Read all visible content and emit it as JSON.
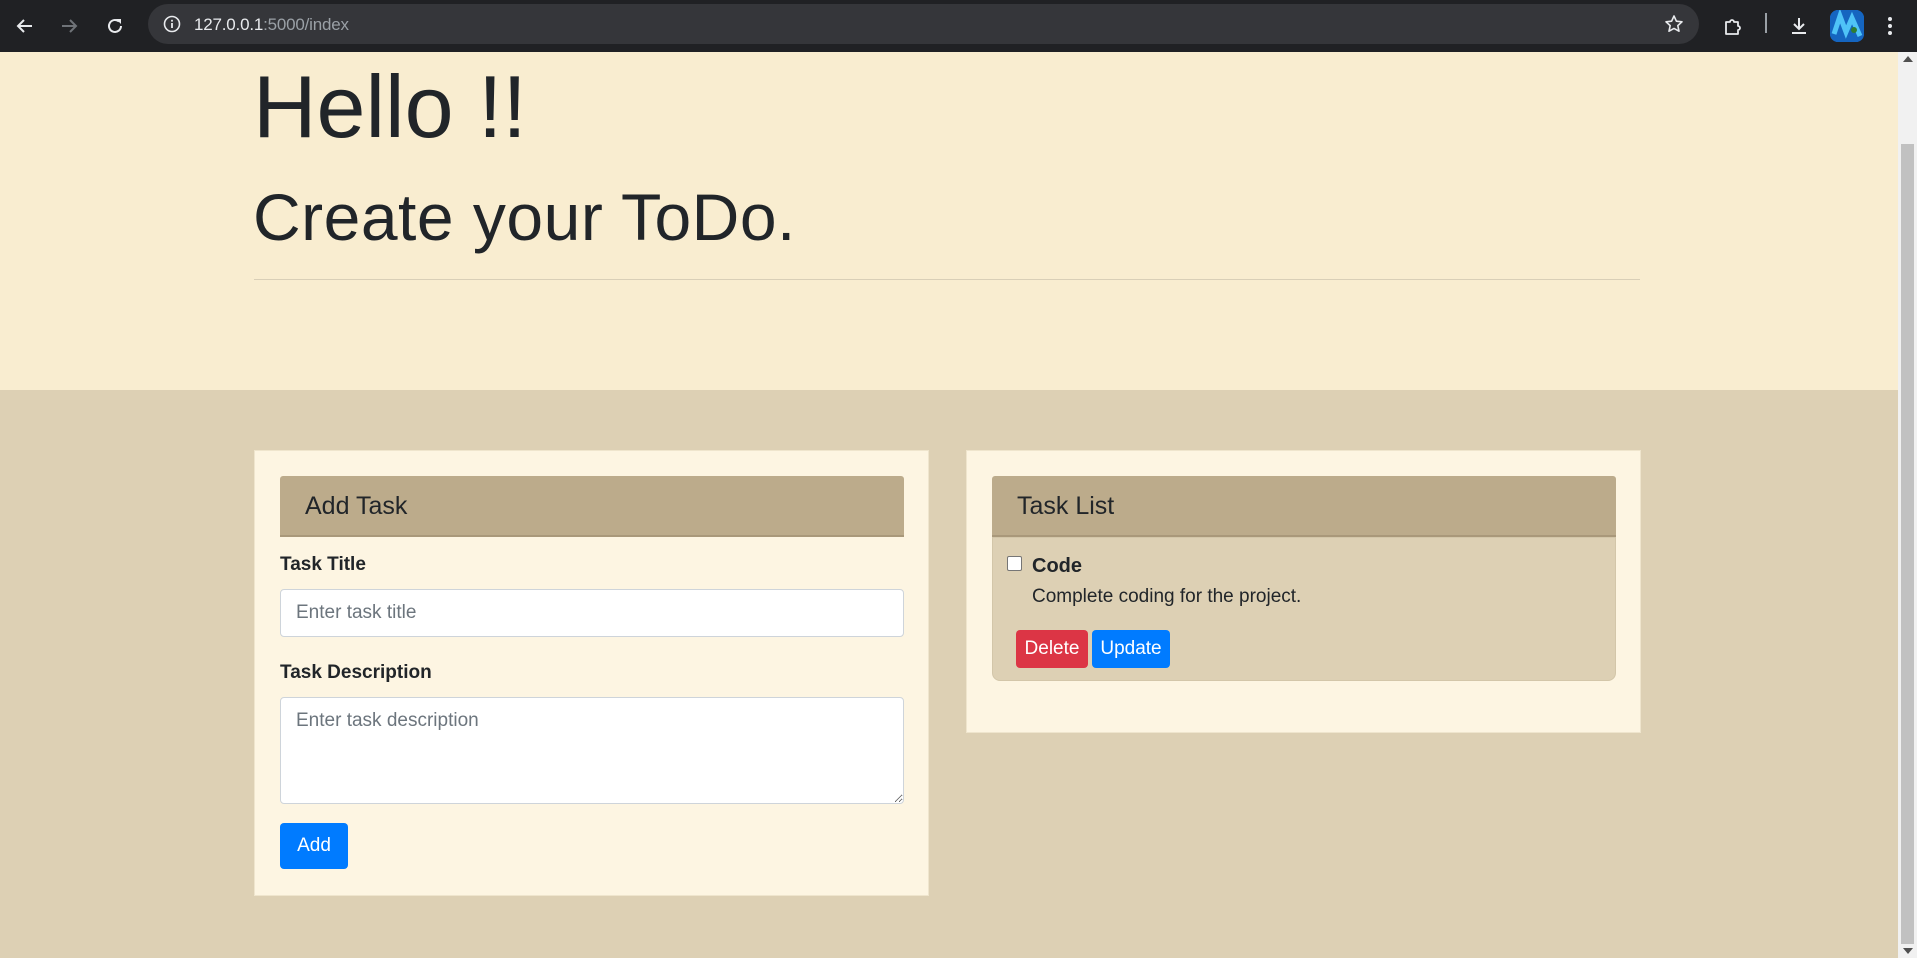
{
  "browser": {
    "url_host": "127.0.0.1",
    "url_path": ":5000/index",
    "icons": {
      "back": "back-arrow-icon",
      "forward": "forward-arrow-icon",
      "reload": "reload-icon",
      "info": "site-info-icon",
      "bookmark": "star-icon",
      "extensions": "puzzle-icon",
      "downloads": "download-icon",
      "profile": "profile-avatar-icon",
      "menu": "kebab-menu-icon"
    }
  },
  "hero": {
    "greeting": "Hello !!",
    "lead": "Create your ToDo."
  },
  "add_task": {
    "header": "Add Task",
    "title_label": "Task Title",
    "title_placeholder": "Enter task title",
    "title_value": "",
    "description_label": "Task Description",
    "description_placeholder": "Enter task description",
    "description_value": "",
    "add_button": "Add"
  },
  "task_list": {
    "header": "Task List",
    "tasks": [
      {
        "title": "Code",
        "description": "Complete coding for the project.",
        "completed": false,
        "delete_label": "Delete",
        "update_label": "Update"
      }
    ]
  },
  "colors": {
    "hero_background": "#f9edd0",
    "page_background": "#ddd0b4",
    "card_background": "#fdf5e2",
    "card_header": "#bcab8b",
    "primary": "#007bff",
    "danger": "#dc3545"
  }
}
